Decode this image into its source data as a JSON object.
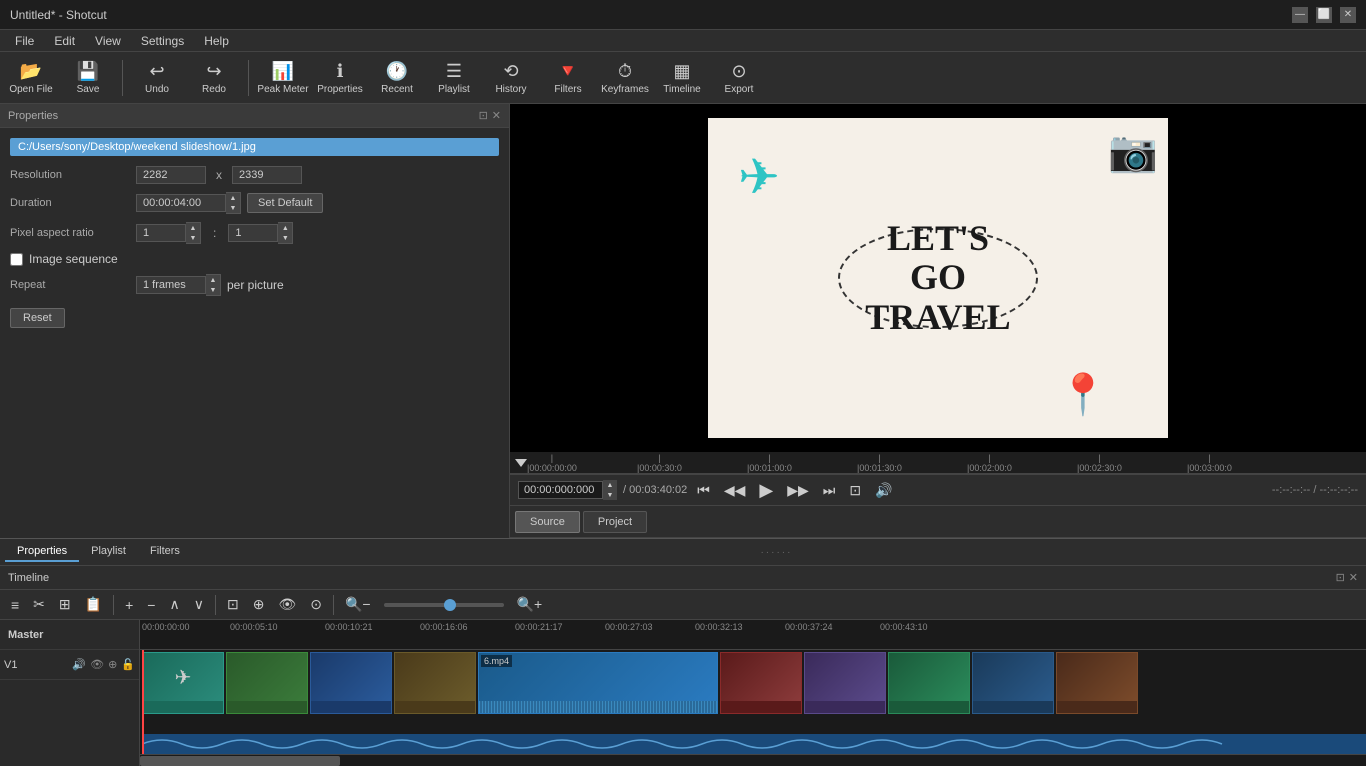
{
  "window": {
    "title": "Untitled* - Shotcut",
    "controls": [
      "minimize",
      "maximize",
      "close"
    ]
  },
  "menubar": {
    "items": [
      "File",
      "Edit",
      "View",
      "Settings",
      "Help"
    ]
  },
  "toolbar": {
    "buttons": [
      {
        "id": "open-file",
        "icon": "📂",
        "label": "Open File"
      },
      {
        "id": "save",
        "icon": "💾",
        "label": "Save"
      },
      {
        "id": "undo",
        "icon": "↩",
        "label": "Undo"
      },
      {
        "id": "redo",
        "icon": "↪",
        "label": "Redo"
      },
      {
        "id": "peak-meter",
        "icon": "📊",
        "label": "Peak Meter"
      },
      {
        "id": "properties",
        "icon": "ℹ",
        "label": "Properties"
      },
      {
        "id": "recent",
        "icon": "🕐",
        "label": "Recent"
      },
      {
        "id": "playlist",
        "icon": "☰",
        "label": "Playlist"
      },
      {
        "id": "history",
        "icon": "⟲",
        "label": "History"
      },
      {
        "id": "filters",
        "icon": "🔻",
        "label": "Filters"
      },
      {
        "id": "keyframes",
        "icon": "⏱",
        "label": "Keyframes"
      },
      {
        "id": "timeline",
        "icon": "▦",
        "label": "Timeline"
      },
      {
        "id": "export",
        "icon": "⊙",
        "label": "Export"
      }
    ]
  },
  "properties_panel": {
    "title": "Properties",
    "file_path": "C:/Users/sony/Desktop/weekend slideshow/1.jpg",
    "resolution_label": "Resolution",
    "resolution_w": "2282",
    "resolution_x": "x",
    "resolution_h": "2339",
    "duration_label": "Duration",
    "duration_value": "00:00:04:00",
    "set_default_btn": "Set Default",
    "pixel_aspect_label": "Pixel aspect ratio",
    "pixel_aspect_1": "1",
    "pixel_aspect_2": "1",
    "image_sequence_label": "Image sequence",
    "repeat_label": "Repeat",
    "repeat_value": "1 frames",
    "per_picture": "per picture",
    "reset_btn": "Reset"
  },
  "preview": {
    "travel_text": "LET'S\nGO\nTRAVEL"
  },
  "timeline_ruler": {
    "marks": [
      {
        "time": "00:00:00:00",
        "pos": 0
      },
      {
        "time": "|00:00:30:0",
        "pos": 110
      },
      {
        "time": "|00:01:00:0",
        "pos": 220
      },
      {
        "time": "|00:01:30:0",
        "pos": 330
      },
      {
        "time": "|00:02:00:0",
        "pos": 440
      },
      {
        "time": "|00:02:30:0",
        "pos": 550
      },
      {
        "time": "|00:03:00:0",
        "pos": 660
      }
    ]
  },
  "playback": {
    "current_time": "00:00:000:000",
    "total_time": "/ 00:03:40:02",
    "buttons": [
      "⏮",
      "◀◀",
      "▶",
      "▶▶",
      "⏭"
    ],
    "volume": "🔊",
    "time_right": "--:--:--:-- / --:--:--:--"
  },
  "source_project_tabs": {
    "tabs": [
      "Source",
      "Project"
    ],
    "active": "Source"
  },
  "bottom_tabs": {
    "tabs": [
      "Properties",
      "Playlist",
      "Filters"
    ],
    "active": "Properties"
  },
  "timeline": {
    "title": "Timeline",
    "toolbar_buttons": [
      "≡",
      "✂",
      "⊞",
      "📋",
      "+",
      "−",
      "∧",
      "∨",
      "⊡",
      "⊙",
      "👁",
      "⊕",
      "🔍−",
      "🔍+"
    ],
    "tracks": [
      {
        "name": "Master",
        "type": "master"
      },
      {
        "name": "V1",
        "type": "video"
      }
    ],
    "ruler_times": [
      "00:00:00:00",
      "00:00:05:10",
      "00:00:10:21",
      "00:00:16:06",
      "00:00:21:17",
      "00:00:27:03",
      "00:00:32:13",
      "00:00:37:24",
      "00:00:43:10"
    ],
    "clip_label": "6.mp4"
  }
}
